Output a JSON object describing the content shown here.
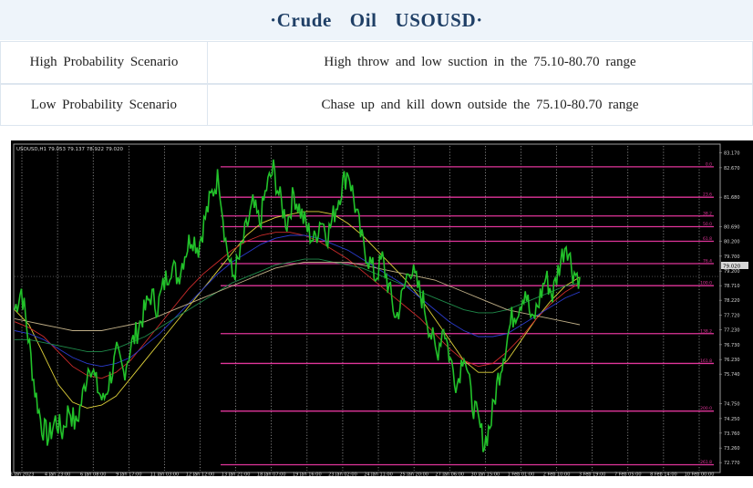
{
  "title": "·Crude   Oil   USOUSD·",
  "scenarios": [
    {
      "label": "High Probability Scenario",
      "text": "High throw and low suction in the 75.10-80.70 range"
    },
    {
      "label": "Low Probability Scenario",
      "text": "Chase up and kill down outside the 75.10-80.70 range"
    }
  ],
  "chart_data": {
    "type": "line",
    "symbol_header": "USOUSD,H1  79.053 79.137 78.922 79.020",
    "current_price": "79.020",
    "y_ticks": [
      "83.170",
      "82.670",
      "81.680",
      "80.690",
      "80.200",
      "79.700",
      "79.200",
      "78.710",
      "78.220",
      "77.720",
      "77.230",
      "76.730",
      "76.230",
      "75.740",
      "74.750",
      "74.250",
      "73.760",
      "73.260",
      "72.770"
    ],
    "x_ticks": [
      "3 Jan 2023",
      "4 Jan 23:00",
      "6 Jan 08:00",
      "9 Jan 17:00",
      "11 Jan 03:00",
      "12 Jan 12:00",
      "13 Jan 21:00",
      "18 Jan 07:00",
      "19 Jan 16:00",
      "23 Jan 02:00",
      "24 Jan 11:00",
      "25 Jan 20:00",
      "27 Jan 06:00",
      "30 Jan 15:00",
      "1 Feb 01:00",
      "2 Feb 10:00",
      "3 Feb 19:00",
      "7 Feb 05:00",
      "8 Feb 14:00",
      "10 Feb 00:00"
    ],
    "fib_levels": [
      {
        "price": 82.7,
        "label": "0.0"
      },
      {
        "price": 81.68,
        "label": "23.6"
      },
      {
        "price": 81.05,
        "label": "38.2"
      },
      {
        "price": 80.69,
        "label": "50.0"
      },
      {
        "price": 80.2,
        "label": "61.8"
      },
      {
        "price": 79.45,
        "label": "76.4"
      },
      {
        "price": 78.71,
        "label": "100.0"
      },
      {
        "price": 77.1,
        "label": "138.2"
      },
      {
        "price": 76.1,
        "label": "161.8"
      },
      {
        "price": 74.5,
        "label": "200.0"
      },
      {
        "price": 72.7,
        "label": "261.8"
      }
    ],
    "price_series": [
      77.9,
      78.6,
      77.0,
      75.2,
      74.0,
      73.6,
      74.2,
      73.8,
      74.6,
      74.0,
      75.0,
      76.2,
      75.4,
      74.8,
      75.6,
      76.4,
      75.8,
      76.6,
      77.2,
      77.8,
      78.4,
      78.0,
      78.8,
      79.4,
      79.0,
      79.8,
      80.4,
      80.0,
      81.0,
      81.8,
      82.4,
      80.2,
      79.0,
      79.6,
      80.6,
      81.4,
      80.8,
      82.0,
      82.6,
      81.6,
      80.8,
      81.8,
      81.2,
      80.6,
      80.2,
      81.0,
      80.4,
      81.2,
      82.0,
      82.6,
      81.4,
      80.2,
      79.6,
      79.0,
      79.6,
      78.6,
      77.6,
      78.4,
      79.4,
      78.8,
      78.2,
      77.2,
      76.4,
      77.4,
      76.2,
      75.4,
      76.6,
      75.0,
      74.2,
      73.4,
      74.2,
      75.6,
      76.6,
      77.6,
      78.0,
      78.6,
      77.4,
      78.2,
      79.0,
      78.4,
      79.4,
      80.2,
      79.2,
      79.0
    ],
    "ma_series": [
      {
        "color": "#e0d23a",
        "values": [
          77.9,
          77.4,
          76.4,
          75.4,
          74.8,
          74.6,
          74.7,
          75.0,
          75.6,
          76.2,
          76.8,
          77.4,
          78.0,
          78.6,
          79.2,
          79.8,
          80.4,
          80.8,
          81.0,
          81.1,
          81.2,
          81.2,
          81.1,
          80.8,
          80.4,
          79.9,
          79.4,
          78.9,
          78.3,
          77.6,
          76.9,
          76.2,
          75.8,
          75.8,
          76.2,
          76.9,
          77.6,
          78.2,
          78.7,
          79.0
        ]
      },
      {
        "color": "#cc2b2b",
        "values": [
          77.5,
          77.3,
          77.0,
          76.5,
          76.0,
          75.7,
          75.6,
          75.8,
          76.2,
          76.8,
          77.4,
          78.0,
          78.6,
          79.1,
          79.5,
          79.9,
          80.2,
          80.4,
          80.5,
          80.5,
          80.4,
          80.2,
          79.9,
          79.6,
          79.2,
          78.8,
          78.4,
          78.0,
          77.6,
          77.1,
          76.6,
          76.2,
          76.0,
          76.1,
          76.5,
          77.0,
          77.6,
          78.1,
          78.5,
          78.8
        ]
      },
      {
        "color": "#2a3bcc",
        "values": [
          77.2,
          77.1,
          76.9,
          76.6,
          76.3,
          76.1,
          76.0,
          76.1,
          76.3,
          76.7,
          77.1,
          77.6,
          78.1,
          78.6,
          79.1,
          79.5,
          79.8,
          80.1,
          80.3,
          80.4,
          80.4,
          80.3,
          80.1,
          79.9,
          79.6,
          79.3,
          79.0,
          78.7,
          78.3,
          77.9,
          77.5,
          77.2,
          77.0,
          77.0,
          77.1,
          77.4,
          77.7,
          78.0,
          78.3,
          78.5
        ]
      },
      {
        "color": "#1f8a4a",
        "values": [
          76.9,
          76.9,
          76.8,
          76.7,
          76.6,
          76.5,
          76.5,
          76.6,
          76.8,
          77.0,
          77.3,
          77.6,
          77.9,
          78.2,
          78.5,
          78.8,
          79.0,
          79.2,
          79.4,
          79.5,
          79.6,
          79.6,
          79.5,
          79.4,
          79.3,
          79.1,
          78.9,
          78.7,
          78.5,
          78.3,
          78.1,
          77.9,
          77.8,
          77.8,
          77.9,
          78.1,
          78.3,
          78.5,
          78.7,
          78.8
        ]
      },
      {
        "color": "#bfae86",
        "values": [
          77.6,
          77.5,
          77.4,
          77.3,
          77.2,
          77.2,
          77.2,
          77.3,
          77.4,
          77.5,
          77.7,
          77.9,
          78.1,
          78.3,
          78.5,
          78.7,
          78.9,
          79.1,
          79.3,
          79.4,
          79.5,
          79.5,
          79.5,
          79.5,
          79.4,
          79.3,
          79.2,
          79.1,
          79.0,
          78.9,
          78.7,
          78.5,
          78.3,
          78.1,
          77.9,
          77.8,
          77.7,
          77.6,
          77.5,
          77.4
        ]
      }
    ],
    "y_range": [
      72.5,
      83.4
    ],
    "grid": true
  }
}
